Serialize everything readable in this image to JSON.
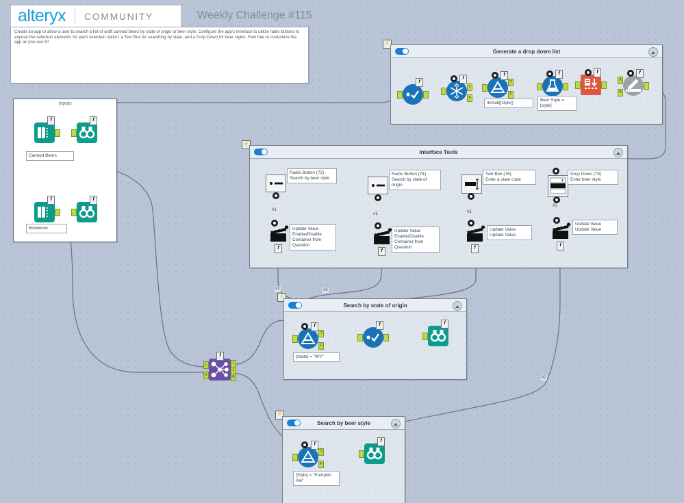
{
  "header": {
    "logo_word": "alteryx",
    "logo_community": "COMMUNITY",
    "challenge_title": "Weekly Challenge #115",
    "brand_blue": "#1a9fd9",
    "community_gray": "#8d8d8d"
  },
  "description": {
    "text": "Create an app to allow a user to search a list of craft canned beers by state of origin or beer style.  Configure the app's interface to utilize radio buttons to expose the selection elements for each selection option: a Text Box for searching by state, and a Drop-Down for beer styles.  Feel free to customize the app as you see fit!"
  },
  "containers": {
    "inputs": {
      "title": "Inputs"
    },
    "dropdown": {
      "title": "Generate a drop down list"
    },
    "interface": {
      "title": "Interface Tools"
    },
    "state": {
      "title": "Search by state of origin"
    },
    "style": {
      "title": "Search by beer style"
    }
  },
  "tools": {
    "canned_beers": {
      "label": "Canned Beers",
      "icon": "input-data-icon"
    },
    "breweries": {
      "label": "Breweries",
      "icon": "input-data-icon"
    },
    "browse1": {
      "icon": "browse-icon"
    },
    "browse2": {
      "icon": "browse-icon"
    },
    "join": {
      "icon": "join-icon"
    }
  },
  "dropdown_tools": {
    "select": {
      "icon": "select-icon"
    },
    "unique": {
      "icon": "unique-icon"
    },
    "filter": {
      "icon": "filter-icon",
      "expression": "!IsNull([style])"
    },
    "formula": {
      "icon": "formula-icon",
      "expression": "Beer Style = [style]"
    },
    "sort": {
      "icon": "sort-icon"
    },
    "append": {
      "icon": "append-fields-icon"
    }
  },
  "interface_tools": [
    {
      "icon": "radio-button-icon",
      "name": "Radio Button (72)",
      "question": "Search by beer style",
      "action": {
        "icon": "action-icon",
        "name": "Update Value",
        "desc": "Enable/Disable Container from Question"
      },
      "conn_label": "#1"
    },
    {
      "icon": "radio-button-icon",
      "name": "Radio Button (74)",
      "question": "Search by state of origin",
      "action": {
        "icon": "action-icon",
        "name": "Update Value",
        "desc": "Enable/Disable Container from Question"
      },
      "conn_label": "#1"
    },
    {
      "icon": "text-box-icon",
      "name": "Text Box (76)",
      "question": "Enter a state code",
      "action": {
        "icon": "action-icon",
        "name": "Update Value",
        "desc": "Update Value"
      },
      "conn_label": "#1"
    },
    {
      "icon": "drop-down-icon",
      "name": "Drop Down (78)",
      "question": "Enter beer style",
      "action": {
        "icon": "action-icon",
        "name": "Update Value",
        "desc": "Update Value"
      },
      "conn_label": "#1"
    }
  ],
  "state_container": {
    "filter": {
      "icon": "filter-icon",
      "expression": "[State] = \"WY\""
    },
    "select": {
      "icon": "select-icon"
    },
    "browse": {
      "icon": "browse-icon"
    }
  },
  "style_container": {
    "filter": {
      "icon": "filter-icon",
      "expression": "[Style] = \"Pumpkin Ale\""
    },
    "browse": {
      "icon": "browse-icon"
    }
  },
  "connection_labels": {
    "two_a": "#2",
    "two_b": "#2",
    "two_c": "#2",
    "two_d": "#2"
  },
  "anchors": {
    "t": "T",
    "f": "F",
    "l": "L",
    "j": "J",
    "r": "R",
    "a": "A",
    "b": "B"
  },
  "colors": {
    "canvas": "#b9c5d6",
    "container_fill": "#dfe5ec",
    "blue_tool": "#1a72b8",
    "teal_tool": "#0d9b8a",
    "purple_tool": "#6a4fa8",
    "red_tool": "#e0573f",
    "gray_tool": "#9aa3a8",
    "anchor_green": "#bcd94a"
  }
}
